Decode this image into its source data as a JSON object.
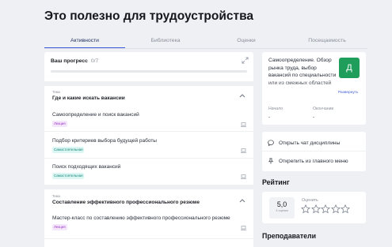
{
  "page": {
    "title": "Это полезно для трудоустройства"
  },
  "tabs": [
    {
      "label": "Активности",
      "active": true
    },
    {
      "label": "Библиотека",
      "active": false
    },
    {
      "label": "Оценки",
      "active": false
    },
    {
      "label": "Посещаемость",
      "active": false
    }
  ],
  "progress": {
    "title": "Ваш прогресс",
    "count": "0/7",
    "fraction": 0.0
  },
  "topics": [
    {
      "caption": "Тема",
      "name": "Где и какие искать вакансии",
      "items": [
        {
          "title": "Самоопределение и поиск вакансий",
          "tag": "Лекция",
          "tag_kind": "lecture"
        },
        {
          "title": "Подбор критериев выбора будущей работы",
          "tag": "Самостоятельная",
          "tag_kind": "self"
        },
        {
          "title": "Поиск подходящих вакансий",
          "tag": "Самостоятельная",
          "tag_kind": "self"
        }
      ]
    },
    {
      "caption": "Тема",
      "name": "Составление эффективного профессионального резюме",
      "items": [
        {
          "title": "Мастер-класс по составлению эффективного профессионального резюме",
          "tag": "Лекция",
          "tag_kind": "lecture"
        }
      ]
    }
  ],
  "course": {
    "description": "Самоопределение. Обзор рынка труда, выбор вакансий по специальности или из смежных областей",
    "avatar_letter": "Д",
    "avatar_color": "#1f9e5b",
    "expand_label": "Развернуть",
    "start_label": "Начало",
    "start_value": "-",
    "end_label": "Окончание",
    "end_value": "-"
  },
  "actions": {
    "chat_label": "Открыть чат дисциплины",
    "unpin_label": "Открепить из главного меню"
  },
  "rating": {
    "heading": "Рейтинг",
    "value": "5,0",
    "count": "3 оценки",
    "rate_label": "Оценить",
    "stars_total": 5
  },
  "teachers": {
    "heading": "Преподаватели"
  },
  "colors": {
    "accent": "#3b5bdb",
    "lecture_tag": "#9b3bc4",
    "self_tag": "#17857a",
    "background": "#eef0f4"
  }
}
